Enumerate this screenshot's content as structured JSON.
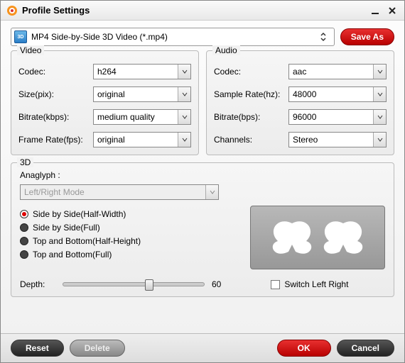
{
  "window": {
    "title": "Profile Settings"
  },
  "profile": {
    "selected": "MP4 Side-by-Side 3D Video (*.mp4)",
    "save_as": "Save As"
  },
  "video": {
    "title": "Video",
    "codec_label": "Codec:",
    "codec_value": "h264",
    "size_label": "Size(pix):",
    "size_value": "original",
    "bitrate_label": "Bitrate(kbps):",
    "bitrate_value": "medium quality",
    "fps_label": "Frame Rate(fps):",
    "fps_value": "original"
  },
  "audio": {
    "title": "Audio",
    "codec_label": "Codec:",
    "codec_value": "aac",
    "sr_label": "Sample Rate(hz):",
    "sr_value": "48000",
    "bitrate_label": "Bitrate(bps):",
    "bitrate_value": "96000",
    "ch_label": "Channels:",
    "ch_value": "Stereo"
  },
  "three_d": {
    "title": "3D",
    "anaglyph_label": "Anaglyph :",
    "mode_placeholder": "Left/Right Mode",
    "options": {
      "sbs_half": "Side by Side(Half-Width)",
      "sbs_full": "Side by Side(Full)",
      "tb_half": "Top and Bottom(Half-Height)",
      "tb_full": "Top and Bottom(Full)"
    },
    "depth_label": "Depth:",
    "depth_value": "60",
    "switch_label": "Switch Left Right"
  },
  "footer": {
    "reset": "Reset",
    "delete": "Delete",
    "ok": "OK",
    "cancel": "Cancel"
  }
}
